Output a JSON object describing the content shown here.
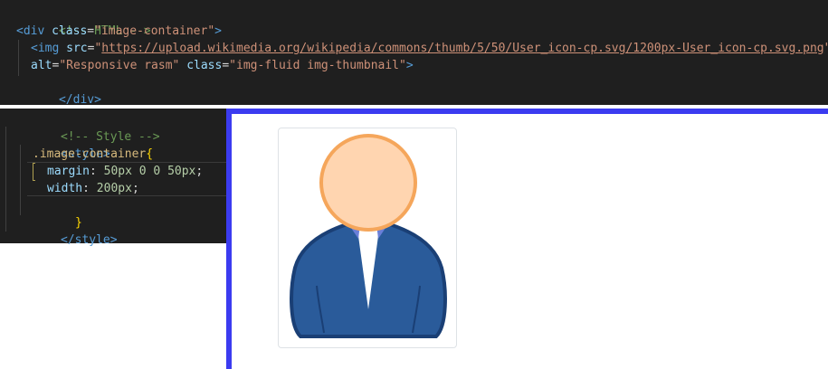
{
  "html_panel": {
    "lines": [
      "<!-- HTML -->",
      "<div class=\"image-container\">",
      "<img src=\"https://upload.wikimedia.org/wikipedia/commons/thumb/5/50/User_icon-cp.svg/1200px-User_icon-cp.svg.png\"",
      "alt=\"Responsive rasm\" class=\"img-fluid img-thumbnail\">",
      "</div>"
    ],
    "comment": "<!-- HTML -->",
    "div_open_tag": "<div",
    "class_attr": "class",
    "eq": "=",
    "class_value": "\"image-container\"",
    "gt": ">",
    "img_tag": "<img",
    "src_attr": "src",
    "src_q1": "\"",
    "src_url": "https://upload.wikimedia.org/wikipedia/commons/thumb/5/50/User_icon-cp.svg/1200px-User_icon-cp.svg.png",
    "src_q2": "\"",
    "alt_attr": "alt",
    "alt_value": "\"Responsive rasm\"",
    "class_attr2": "class",
    "class_value2": "\"img-fluid img-thumbnail\"",
    "gt2": ">",
    "div_close": "</div>"
  },
  "style_panel": {
    "comment": "<!-- Style -->",
    "style_open": "<style>",
    "selector": ".image-container",
    "brace_open": "{",
    "margin_prop": "margin",
    "colon": ":",
    "margin_value": "50px 0 0 50px",
    "semicolon": ";",
    "width_prop": "width",
    "width_value": "200px",
    "brace_close": "}",
    "style_close": "</style>"
  },
  "preview": {
    "image_alt": "Responsive rasm",
    "colors": {
      "frame": "#3b3bf0",
      "face": "#ffd5b0",
      "face_outline": "#f5a65b",
      "suit": "#2a5b9a",
      "suit_outline": "#1a3f75"
    }
  }
}
